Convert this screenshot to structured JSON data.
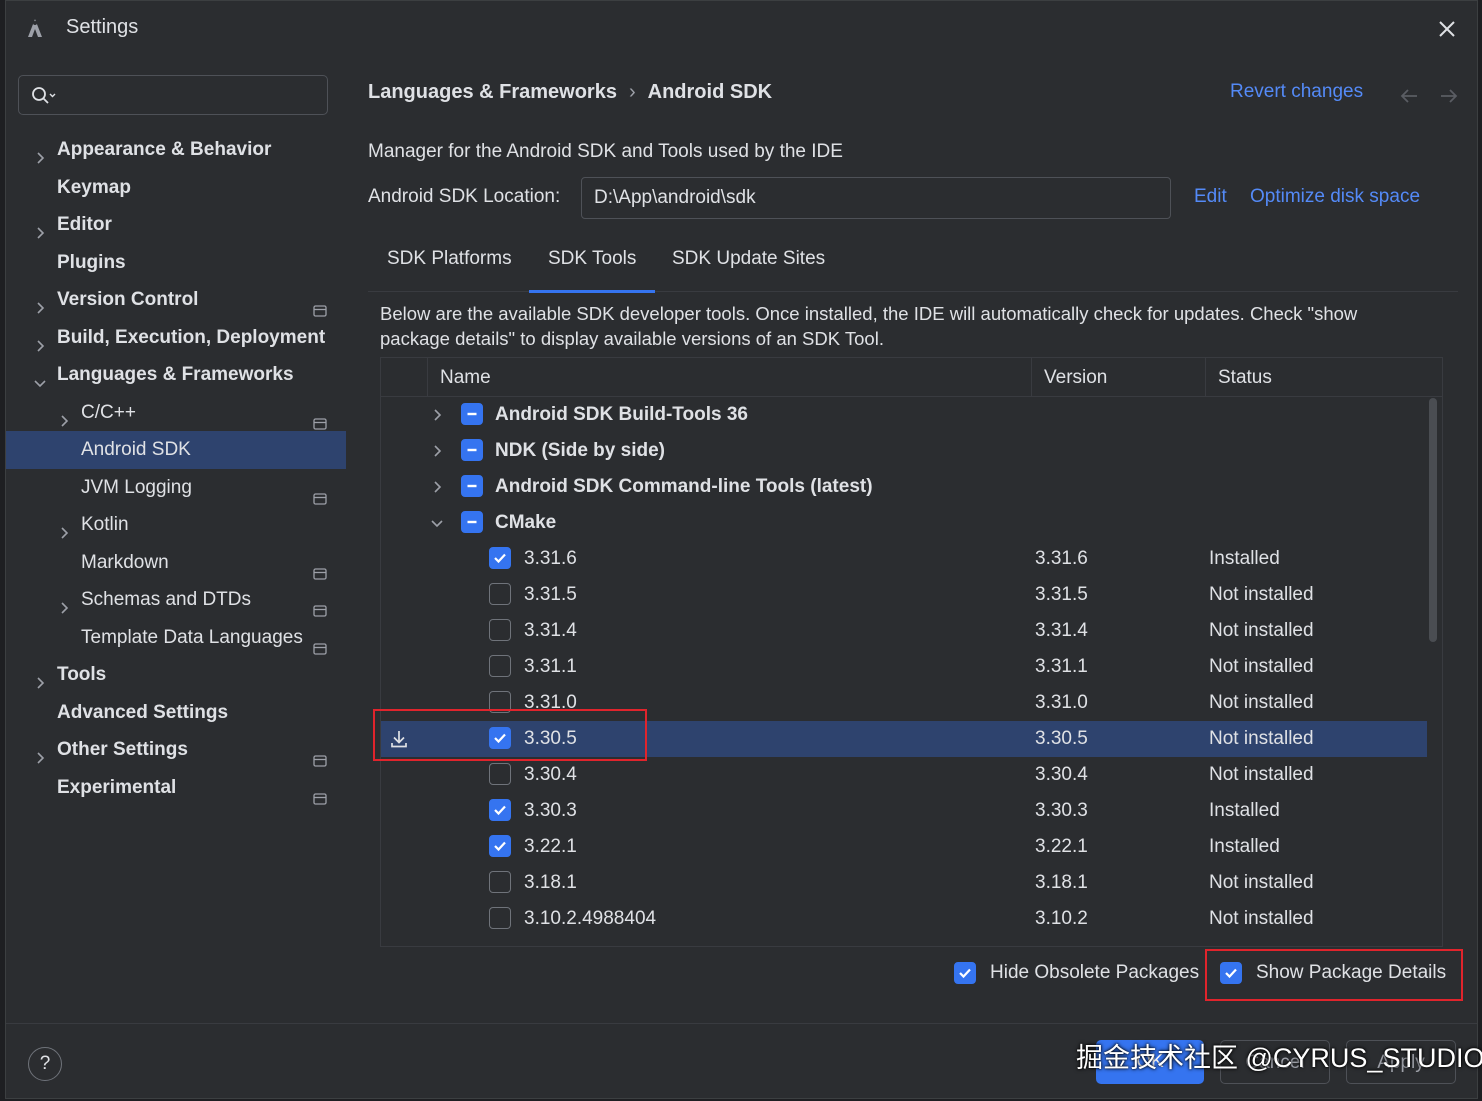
{
  "window": {
    "title": "Settings"
  },
  "search": {
    "placeholder": ""
  },
  "sidebar": {
    "items": [
      {
        "label": "Appearance & Behavior",
        "bold": true,
        "expandable": true,
        "indent": 0
      },
      {
        "label": "Keymap",
        "bold": true,
        "expandable": false,
        "indent": 0
      },
      {
        "label": "Editor",
        "bold": true,
        "expandable": true,
        "indent": 0
      },
      {
        "label": "Plugins",
        "bold": true,
        "expandable": false,
        "indent": 0
      },
      {
        "label": "Version Control",
        "bold": true,
        "expandable": true,
        "indent": 0,
        "project": true
      },
      {
        "label": "Build, Execution, Deployment",
        "bold": true,
        "expandable": true,
        "indent": 0
      },
      {
        "label": "Languages & Frameworks",
        "bold": true,
        "expandable": true,
        "expanded": true,
        "indent": 0
      },
      {
        "label": "C/C++",
        "bold": false,
        "expandable": true,
        "indent": 1,
        "project": true
      },
      {
        "label": "Android SDK",
        "bold": false,
        "expandable": false,
        "indent": 1,
        "selected": true
      },
      {
        "label": "JVM Logging",
        "bold": false,
        "expandable": false,
        "indent": 1,
        "project": true
      },
      {
        "label": "Kotlin",
        "bold": false,
        "expandable": true,
        "indent": 1
      },
      {
        "label": "Markdown",
        "bold": false,
        "expandable": false,
        "indent": 1,
        "project": true
      },
      {
        "label": "Schemas and DTDs",
        "bold": false,
        "expandable": true,
        "indent": 1,
        "project": true
      },
      {
        "label": "Template Data Languages",
        "bold": false,
        "expandable": false,
        "indent": 1,
        "project": true
      },
      {
        "label": "Tools",
        "bold": true,
        "expandable": true,
        "indent": 0
      },
      {
        "label": "Advanced Settings",
        "bold": true,
        "expandable": false,
        "indent": 0
      },
      {
        "label": "Other Settings",
        "bold": true,
        "expandable": true,
        "indent": 0,
        "project": true
      },
      {
        "label": "Experimental",
        "bold": true,
        "expandable": false,
        "indent": 0,
        "project": true
      }
    ]
  },
  "header": {
    "breadcrumb_parent": "Languages & Frameworks",
    "breadcrumb_sep": "›",
    "breadcrumb_current": "Android SDK",
    "revert_label": "Revert changes"
  },
  "main": {
    "description": "Manager for the Android SDK and Tools used by the IDE",
    "location_label": "Android SDK Location:",
    "location_value": "D:\\App\\android\\sdk",
    "edit_label": "Edit",
    "optimize_label": "Optimize disk space",
    "tabs": [
      {
        "label": "SDK Platforms",
        "active": false
      },
      {
        "label": "SDK Tools",
        "active": true
      },
      {
        "label": "SDK Update Sites",
        "active": false
      }
    ],
    "panel_description": "Below are the available SDK developer tools. Once installed, the IDE will automatically check for updates. Check \"show package details\" to display available versions of an SDK Tool."
  },
  "table": {
    "columns": [
      "Name",
      "Version",
      "Status"
    ],
    "rows": [
      {
        "type": "group",
        "name": "Android SDK Build-Tools 36",
        "expanded": false,
        "state": "partial",
        "version": "",
        "status": ""
      },
      {
        "type": "group",
        "name": "NDK (Side by side)",
        "expanded": false,
        "state": "partial",
        "version": "",
        "status": ""
      },
      {
        "type": "group",
        "name": "Android SDK Command-line Tools (latest)",
        "expanded": false,
        "state": "partial",
        "version": "",
        "status": ""
      },
      {
        "type": "group",
        "name": "CMake",
        "expanded": true,
        "state": "partial",
        "version": "",
        "status": ""
      },
      {
        "type": "item",
        "name": "3.31.6",
        "state": "checked",
        "version": "3.31.6",
        "status": "Installed"
      },
      {
        "type": "item",
        "name": "3.31.5",
        "state": "unchecked",
        "version": "3.31.5",
        "status": "Not installed"
      },
      {
        "type": "item",
        "name": "3.31.4",
        "state": "unchecked",
        "version": "3.31.4",
        "status": "Not installed"
      },
      {
        "type": "item",
        "name": "3.31.1",
        "state": "unchecked",
        "version": "3.31.1",
        "status": "Not installed"
      },
      {
        "type": "item",
        "name": "3.31.0",
        "state": "unchecked",
        "version": "3.31.0",
        "status": "Not installed"
      },
      {
        "type": "item",
        "name": "3.30.5",
        "state": "checked",
        "version": "3.30.5",
        "status": "Not installed",
        "selected": true,
        "pending_download": true
      },
      {
        "type": "item",
        "name": "3.30.4",
        "state": "unchecked",
        "version": "3.30.4",
        "status": "Not installed"
      },
      {
        "type": "item",
        "name": "3.30.3",
        "state": "checked",
        "version": "3.30.3",
        "status": "Installed"
      },
      {
        "type": "item",
        "name": "3.22.1",
        "state": "checked",
        "version": "3.22.1",
        "status": "Installed"
      },
      {
        "type": "item",
        "name": "3.18.1",
        "state": "unchecked",
        "version": "3.18.1",
        "status": "Not installed"
      },
      {
        "type": "item",
        "name": "3.10.2.4988404",
        "state": "unchecked",
        "version": "3.10.2",
        "status": "Not installed"
      }
    ]
  },
  "options": {
    "hide_obsolete_label": "Hide Obsolete Packages",
    "hide_obsolete_checked": true,
    "show_details_label": "Show Package Details",
    "show_details_checked": true
  },
  "footer": {
    "help_label": "?",
    "ok_label": "OK",
    "cancel_label": "Cancel",
    "apply_label": "Apply"
  },
  "watermark": "掘金技术社区 @CYRUS_STUDIO",
  "colors": {
    "background": "#2b2d30",
    "selection": "#2e436e",
    "accent": "#3574f0",
    "link": "#548af7",
    "highlight_box": "#e0242c"
  },
  "icons": [
    "app-icon",
    "close-icon",
    "search-icon",
    "chevron-right-icon",
    "chevron-down-icon",
    "project-scope-icon",
    "arrow-back-icon",
    "arrow-forward-icon",
    "download-icon",
    "checkbox-icon",
    "help-icon"
  ]
}
